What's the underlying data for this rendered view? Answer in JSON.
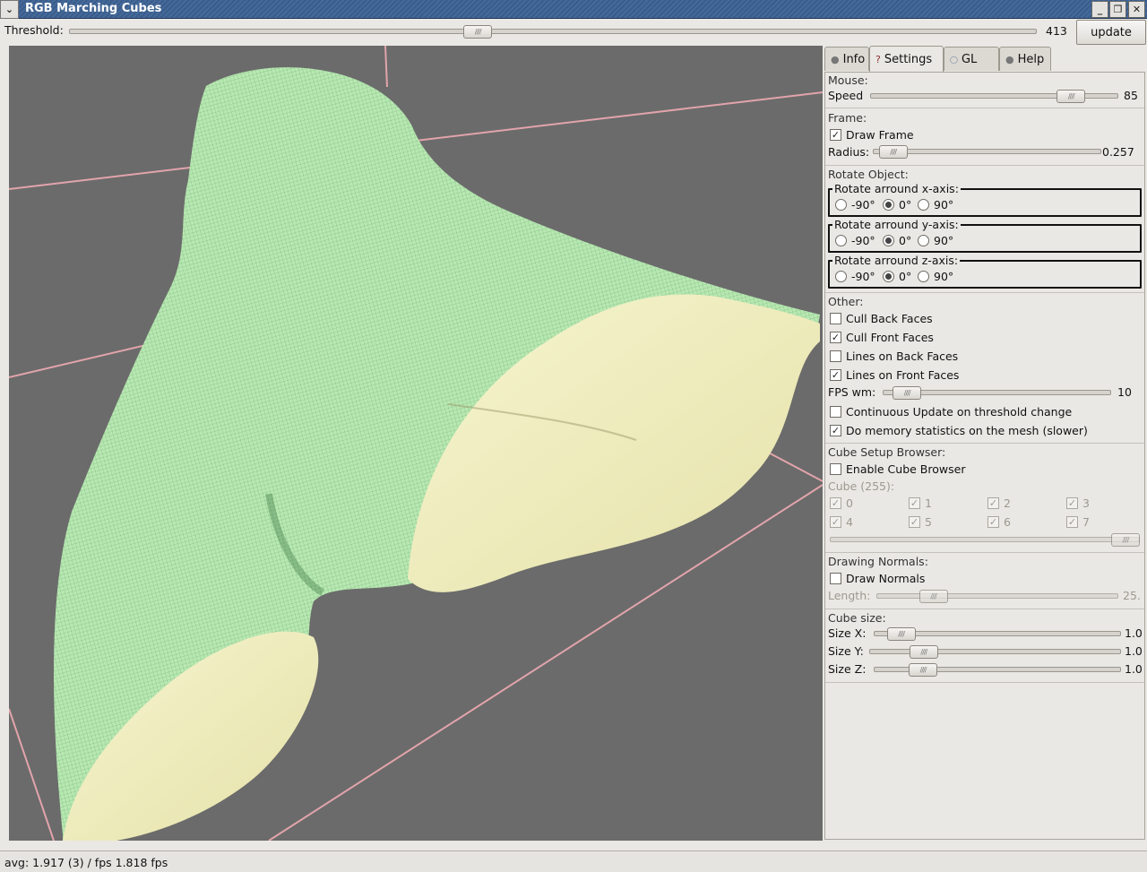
{
  "window": {
    "title": "RGB Marching Cubes"
  },
  "threshold": {
    "label": "Threshold:",
    "value": "413",
    "level": 0.42,
    "button": "update"
  },
  "tabs": [
    {
      "label": "Info",
      "icon": "bulb-icon"
    },
    {
      "label": "Settings",
      "icon": "question-icon"
    },
    {
      "label": "GL",
      "icon": "opengl-logo-icon"
    },
    {
      "label": "Help",
      "icon": "bulb-icon"
    }
  ],
  "active_tab": "Settings",
  "settings": {
    "mouse": {
      "head": "Mouse:",
      "speed_label": "Speed",
      "speed_value": "85",
      "speed_level": 0.85
    },
    "frame": {
      "head": "Frame:",
      "draw_label": "Draw Frame",
      "draw_checked": true,
      "radius_label": "Radius:",
      "radius_value": "0.257",
      "radius_level": 0.03
    },
    "rotate": {
      "head": "Rotate Object:",
      "groups": [
        {
          "title": "Rotate arround x-axis:",
          "options": [
            "-90°",
            "0°",
            "90°"
          ],
          "selected": "0°"
        },
        {
          "title": "Rotate arround y-axis:",
          "options": [
            "-90°",
            "0°",
            "90°"
          ],
          "selected": "0°"
        },
        {
          "title": "Rotate arround z-axis:",
          "options": [
            "-90°",
            "0°",
            "90°"
          ],
          "selected": "0°"
        }
      ]
    },
    "other": {
      "head": "Other:",
      "cull_back": {
        "label": "Cull Back Faces",
        "checked": false
      },
      "cull_front": {
        "label": "Cull Front Faces",
        "checked": true
      },
      "lines_back": {
        "label": "Lines on Back Faces",
        "checked": false
      },
      "lines_front": {
        "label": "Lines on Front Faces",
        "checked": true
      },
      "fps_label": "FPS wm:",
      "fps_value": "10",
      "fps_level": 0.05,
      "continuous": {
        "label": "Continuous Update on threshold change",
        "checked": false
      },
      "memory": {
        "label": "Do memory statistics on the mesh (slower)",
        "checked": true
      }
    },
    "cube_browser": {
      "head": "Cube Setup Browser:",
      "enable": {
        "label": "Enable Cube Browser",
        "checked": false
      },
      "cube_label": "Cube (255):",
      "bits": [
        "0",
        "1",
        "2",
        "3",
        "4",
        "5",
        "6",
        "7"
      ],
      "level": 1.0
    },
    "normals": {
      "head": "Drawing Normals:",
      "draw": {
        "label": "Draw Normals",
        "checked": false
      },
      "length_label": "Length:",
      "length_value": "25.",
      "length_level": 0.2
    },
    "cube_size": {
      "head": "Cube size:",
      "x_label": "Size X:",
      "x_value": "1.0",
      "x_level": 0.06,
      "y_label": "Size Y:",
      "y_value": "1.0",
      "y_level": 0.18,
      "z_label": "Size Z:",
      "z_value": "1.0",
      "z_level": 0.16
    }
  },
  "status": "avg: 1.917 (3) / fps 1.818 fps",
  "colors": {
    "mesh_green": "#b6e9b0",
    "mesh_cream": "#f1efc0",
    "viewport_bg": "#6b6b6b",
    "frame_line": "#e3a0a8"
  }
}
